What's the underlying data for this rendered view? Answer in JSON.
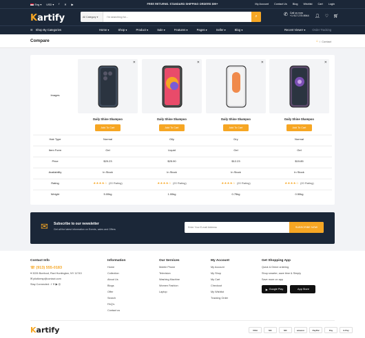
{
  "topbar": {
    "language": "Eng",
    "currency": "USD",
    "promo": "FREE RETURNS. STANDARD SHIPPING ORDERS $99+",
    "links": [
      "My Account",
      "Contact Us",
      "Blog",
      "Wishlist",
      "Cart",
      "Login"
    ]
  },
  "header": {
    "logo_first": "K",
    "logo_rest": "artify",
    "search": {
      "category": "All Category",
      "placeholder": "I'm searching for..."
    },
    "call": {
      "label": "Call us now",
      "number": "+1 917 275 8944"
    }
  },
  "nav": {
    "categories_label": "Shop By Categories",
    "menu": [
      "Home",
      "Shop",
      "Product",
      "Sale",
      "Features",
      "Pages",
      "Seller",
      "Blog"
    ],
    "recent": "Recent Viewer",
    "tracking": "Order Tracking"
  },
  "breadcrumb": {
    "title": "Compare",
    "current": "Contact"
  },
  "compare": {
    "labels": {
      "images": "Images",
      "hair": "Hair Type",
      "form": "Item Form",
      "price": "Price",
      "avail": "Availability",
      "rating": "Rating",
      "weight": "Weight"
    },
    "cart_label": "Add To Cart",
    "products": [
      {
        "name": "Daily Shine Shampoo",
        "hair": "Normal",
        "form": "Gel",
        "price": "$20.23",
        "avail": "In Stock",
        "stars": "★★★★☆",
        "reviews": "(20 Rating)",
        "weight": "5.00kg",
        "color": "#3e4a5a"
      },
      {
        "name": "Daily Shine Shampoo",
        "hair": "Oily",
        "form": "Liquid",
        "price": "$25.90",
        "avail": "In Stock",
        "stars": "★★★★☆",
        "reviews": "(20 Rating)",
        "weight": "1.00kg",
        "color": "#4a4a4a"
      },
      {
        "name": "Daily Shine Shampoo",
        "hair": "Dry",
        "form": "Gel",
        "price": "$12.23",
        "avail": "In Stock",
        "stars": "★★★★☆",
        "reviews": "(20 Rating)",
        "weight": "0.75kg",
        "color": "#e8e8ea"
      },
      {
        "name": "Daily Shine Shampoo",
        "hair": "Normal",
        "form": "Gel",
        "price": "$15.85",
        "avail": "In Stock",
        "stars": "★★★★☆",
        "reviews": "(20 Rating)",
        "weight": "0.50kg",
        "color": "#5b4a6b"
      }
    ]
  },
  "newsletter": {
    "title": "Subscribe to our newsletter",
    "subtitle": "Get all the latest information on Events, sales and Offers",
    "placeholder": "Enter Your E-mail Address",
    "button": "SUBSCRIBE NOW"
  },
  "footer": {
    "contact": {
      "title": "Contact Info",
      "phone": "(913) 555-0183",
      "address": "3226 Bonfood, Ravi Huntington, NY 11743",
      "email": "pilotkresp@contact.com",
      "social_label": "Stay Connected :"
    },
    "information": {
      "title": "Information",
      "links": [
        "Home",
        "Collection",
        "About Us",
        "Blogs",
        "Offer",
        "Search",
        "FAQ's",
        "Contact us"
      ]
    },
    "services": {
      "title": "Our Services",
      "links": [
        "Mobile Phone",
        "Television",
        "Washing Machine",
        "Women Fashion",
        "Laptop"
      ]
    },
    "account": {
      "title": "My Account",
      "links": [
        "My Account",
        "My Shop",
        "My Cart",
        "Checkout",
        "My Wishlist",
        "Tracking Order"
      ]
    },
    "app": {
      "title": "Get Shopping App",
      "lines": [
        "Quick & Direct ordering",
        "Shop smarter, save time & Simply",
        "Save more on app"
      ],
      "google": "Google Play",
      "apple": "App Store"
    },
    "logo_first": "K",
    "logo_rest": "artify",
    "payments": [
      "VISA",
      "MC",
      "MC",
      "amazon",
      "PayPal",
      "Pay",
      "G Pay"
    ]
  },
  "colors": {
    "accent": "#f6a623",
    "dark": "#1b2738"
  }
}
